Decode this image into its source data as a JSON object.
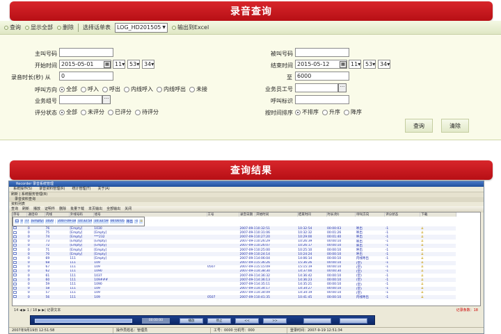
{
  "banner_query": "录音查询",
  "banner_results": "查询结果",
  "toolbar": {
    "query": "查询",
    "show_all": "显示全部",
    "delete": "删除",
    "choose_table_label": "选择话单表",
    "table_value": "LOG_HD201505",
    "export": "输出到Excel"
  },
  "form": {
    "caller_label": "主叫号码",
    "callee_label": "被叫号码",
    "start_label": "开始时间",
    "start_date": "2015-05-01",
    "start_hour": "11",
    "start_min": "53",
    "start_sec": "34",
    "end_label": "结束时间",
    "end_date": "2015-05-12",
    "end_hour": "11",
    "end_min": "53",
    "end_sec": "34",
    "duration_label": "录音时长(秒) 从",
    "duration_from": "0",
    "to_label": "至",
    "duration_to": "6000",
    "direction_label": "呼叫方向",
    "direction_options": [
      "全部",
      "呼入",
      "呼出",
      "内线呼入",
      "内线呼出",
      "未接"
    ],
    "agent_id_label": "业务员工号",
    "group_label": "业务组号",
    "call_id_label": "呼叫标识",
    "score_label": "评分状态",
    "score_options": [
      "全部",
      "未评分",
      "已评分",
      "待评分"
    ],
    "sort_label": "按时间排序",
    "sort_options": [
      "不排序",
      "升序",
      "降序"
    ],
    "query_button": "查询",
    "clear_button": "清除"
  },
  "window": {
    "title": "Recorder 录音系统管理",
    "menu": [
      "系统操作(S)",
      "录音资料管理(R)",
      "统计管理(T)",
      "关于(A)"
    ],
    "toolbar": "刷新  |  系统服务管理(B)",
    "tab": "录音资料查询",
    "subtitle": "资料列表",
    "tb2": [
      "查询",
      "刷新",
      "播放",
      "证明件",
      "删除",
      "批量下载",
      "本页输出",
      "全部输出",
      "关闭"
    ],
    "columns": [
      "序号",
      "通话ID",
      "内线",
      "外线号码",
      "组号",
      "工号",
      "录音日期",
      "开始时间",
      "结束时间",
      "时长(秒)",
      "呼叫方向",
      "评分状态",
      "下载"
    ],
    "rows": [
      [
        "0",
        "77",
        "[Empty]",
        "1020",
        "",
        "2007-09-18",
        "10:32:54",
        "10:32:59",
        "00:00:05",
        "呼出",
        "-1"
      ],
      [
        "0",
        "76",
        "[Empty]",
        "1030",
        "",
        "2007-09-18",
        "10:32:51",
        "10:32:54",
        "00:00:03",
        "呼出",
        "-1"
      ],
      [
        "0",
        "75",
        "[Empty]",
        "[Empty]",
        "",
        "2007-09-18",
        "10:31:06",
        "10:32:32",
        "00:01:26",
        "呼出",
        "-1"
      ],
      [
        "0",
        "74",
        "[Empty]",
        "***232",
        "",
        "2007-09-18",
        "10:27:20",
        "10:29:00",
        "00:01:40",
        "呼出",
        "-1"
      ],
      [
        "0",
        "73",
        "[Empty]",
        "[Empty]",
        "",
        "2007-09-18",
        "10:26:29",
        "10:26:39",
        "00:00:10",
        "呼出",
        "-1"
      ],
      [
        "0",
        "72",
        "[Empty]",
        "[Empty]",
        "",
        "2007-09-18",
        "10:26:07",
        "10:26:17",
        "00:00:10",
        "呼出",
        "-1"
      ],
      [
        "0",
        "71",
        "[Empty]",
        "[Empty]",
        "",
        "2007-09-18",
        "10:25:00",
        "10:25:10",
        "00:00:10",
        "呼出",
        "-1"
      ],
      [
        "0",
        "70",
        "[Empty]",
        "[Empty]",
        "",
        "2007-09-18",
        "10:24:14",
        "10:24:24",
        "00:00:10",
        "呼出",
        "-1"
      ],
      [
        "0",
        "69",
        "111",
        "[Empty]",
        "",
        "2007-09-13",
        "14:06:04",
        "14:06:14",
        "00:00:10",
        "内线呼出",
        "-1"
      ],
      [
        "0",
        "68",
        "111",
        "109",
        "",
        "2007-09-13",
        "15:36:26",
        "15:36:26",
        "00:00:10",
        "(空)",
        "-1"
      ],
      [
        "0",
        "67",
        "111",
        "109",
        "0507",
        "2007-09-13",
        "15:15:09",
        "15:15:19",
        "00:00:10",
        "(空)",
        "-1"
      ],
      [
        "0",
        "62",
        "111",
        "1090",
        "",
        "2007-09-13",
        "14:38:30",
        "14:37:00",
        "00:00:30",
        "(空)",
        "-1"
      ],
      [
        "0",
        "61",
        "111",
        "1037",
        "",
        "2007-09-13",
        "14:36:32",
        "14:36:42",
        "00:00:10",
        "(空)",
        "-1"
      ],
      [
        "0",
        "60",
        "111",
        "109###",
        "",
        "2007-09-13",
        "14:36:13",
        "14:36:23",
        "00:00:10",
        "(空)",
        "-1"
      ],
      [
        "0",
        "59",
        "111",
        "1090",
        "",
        "2007-09-13",
        "14:35:11",
        "14:35:21",
        "00:00:10",
        "(空)",
        "-1"
      ],
      [
        "0",
        "58",
        "111",
        "109",
        "",
        "2007-09-13",
        "14:34:17",
        "14:34:27",
        "00:00:10",
        "(空)",
        "-1"
      ],
      [
        "0",
        "57",
        "111",
        "109",
        "",
        "2007-09-13",
        "14:34:09",
        "14:34:19",
        "00:00:10",
        "(空)",
        "-1"
      ],
      [
        "0",
        "56",
        "111",
        "109",
        "0507",
        "2007-09-13",
        "10:41:35",
        "10:41:45",
        "00:00:10",
        "内线呼出",
        "-1"
      ]
    ],
    "pager": "14  ◀  ▶  1 / 18  ▶  ▶|  记录文本",
    "pager_right": "记录条数：18",
    "player": {
      "display": "00:00:00",
      "play": "播放",
      "stop": "停止",
      "prev": "<<",
      "next": ">>"
    },
    "status": [
      "2007年9月19日 12:51:58",
      "操作员姓名：管理员",
      "工号：0000  分机号：000",
      "登录时间：2007-9-19 12:51:34"
    ]
  }
}
